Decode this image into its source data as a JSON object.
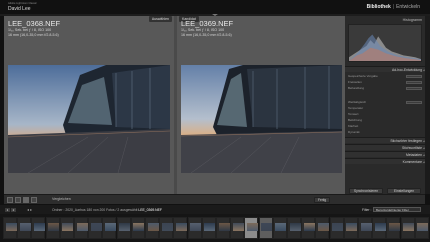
{
  "app": {
    "brand_small": "Adobe Lightroom Classic",
    "brand": "David Lee",
    "modules": [
      "Bibliothek",
      "Entwickeln"
    ],
    "active_module": "Bibliothek"
  },
  "compare": {
    "left": {
      "tag": "Auswählen",
      "filename": "LEE_0368.NEF",
      "meta1": "1/₆₀ Sek. bei ƒ / 8, ISO 100",
      "meta2": "16 mm (16,0-35,0 mm f/2.8-5.6)"
    },
    "right": {
      "tag": "Kandidat",
      "filename": "LEE_0369.NEF",
      "meta1": "1/₆₀ Sek. bei ƒ / 8, ISO 100",
      "meta2": "16 mm (16,0-35,0 mm f/2.8-5.6)"
    }
  },
  "right_panel": {
    "histogram_label": "Histogramm",
    "quick_develop_label": "Ad-hoc-Entwicklung",
    "row_labels": [
      "Gespeicherte Vorgabe",
      "Freistellen",
      "Behandlung",
      "Weißabgleich",
      "Temperatur",
      "Tonwert",
      "Belichtung",
      "Klarheit",
      "Dynamik"
    ],
    "row_values": [
      "Standard",
      "Original",
      "Farbe",
      "Wie Aufnahme",
      "",
      "",
      "",
      "",
      ""
    ],
    "sections": [
      "Stichwörter festlegen",
      "Stichwortliste",
      "Metadaten",
      "Kommentare"
    ],
    "sync_button": "Synchronisieren",
    "reset_button": "Einstellungen"
  },
  "toolbar": {
    "compare_label": "Vergleichen",
    "done_button": "Fertig"
  },
  "filmstrip_bar": {
    "numbers": [
      "1",
      "2"
    ],
    "path": "Ordner : 2020_Aarhus",
    "photo_count": "180 von 200 Fotos / 2 ausgewählt",
    "current_file": "LEE_0369.NEF",
    "filter_label": "Filter :",
    "filter_value": "Benutzerdefinierter Filter"
  },
  "icons": {
    "grid": "grid-icon",
    "loupe": "loupe-icon",
    "compare": "compare-icon",
    "survey": "survey-icon"
  },
  "colors": {
    "panel_bg": "#2a2a2a",
    "compare_bg": "#585858",
    "selected_thumb": "#8c8c8c"
  }
}
